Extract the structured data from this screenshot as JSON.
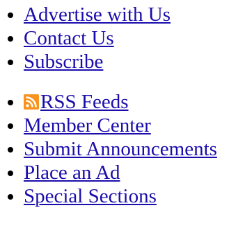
{
  "lists": {
    "top": [
      {
        "label": "Advertise with Us"
      },
      {
        "label": "Contact Us"
      },
      {
        "label": "Subscribe"
      }
    ],
    "bottom": [
      {
        "label": "RSS Feeds",
        "icon": "rss-feed-icon"
      },
      {
        "label": "Member Center"
      },
      {
        "label": "Submit Announcements"
      },
      {
        "label": "Place an Ad"
      },
      {
        "label": "Special Sections"
      }
    ]
  },
  "colors": {
    "link": "#1a0dab",
    "rss_icon": "#f7931e"
  }
}
